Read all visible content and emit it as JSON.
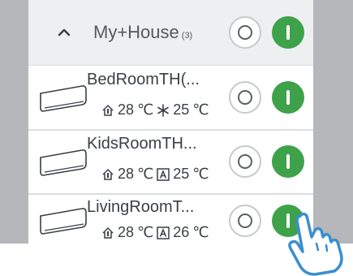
{
  "group": {
    "title": "My+House",
    "count": "(3)",
    "expand_icon": "chevron-up-icon"
  },
  "devices": [
    {
      "name": "BedRoomTH(...",
      "indoor_temp": "28",
      "unit": "℃",
      "mode_icon": "snowflake-icon",
      "set_temp": "25",
      "set_unit": "℃"
    },
    {
      "name": "KidsRoomTH...",
      "indoor_temp": "28",
      "unit": "℃",
      "mode_icon": "auto-mode-icon",
      "set_temp": "25",
      "set_unit": "℃"
    },
    {
      "name": "LivingRoomT...",
      "indoor_temp": "28",
      "unit": "℃",
      "mode_icon": "auto-mode-icon",
      "set_temp": "26",
      "set_unit": "℃"
    }
  ],
  "colors": {
    "on": "#3ea24a",
    "rail": "#b5b7ba",
    "header_bg": "#eeeff1"
  }
}
